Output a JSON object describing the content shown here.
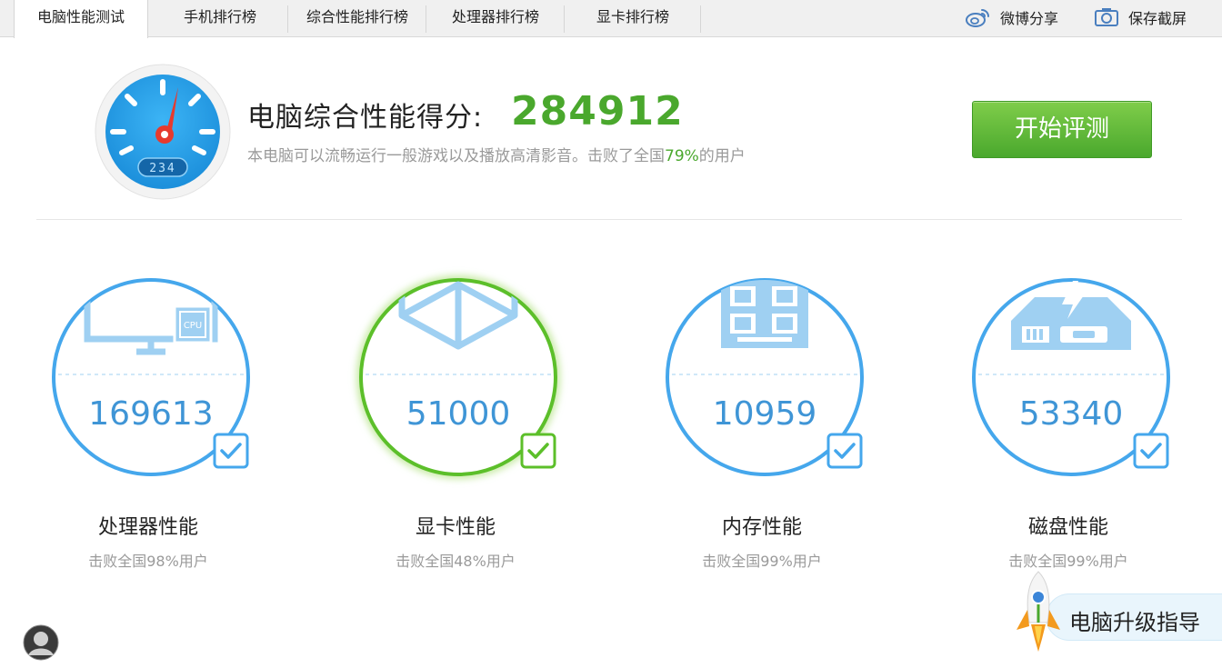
{
  "tabs": [
    {
      "label": "电脑性能测试",
      "active": true
    },
    {
      "label": "手机排行榜"
    },
    {
      "label": "综合性能排行榜"
    },
    {
      "label": "处理器排行榜"
    },
    {
      "label": "显卡排行榜"
    }
  ],
  "actions": {
    "weibo_share": "微博分享",
    "save_screenshot": "保存截屏"
  },
  "score": {
    "title": "电脑综合性能得分:",
    "value": "284912",
    "desc_prefix": "本电脑可以流畅运行一般游戏以及播放高清影音。击败了全国",
    "desc_pct": "79%",
    "desc_suffix": "的用户",
    "gauge_display": "234"
  },
  "start_button": "开始评测",
  "components": [
    {
      "name": "处理器性能",
      "score": "169613",
      "beat": "击败全国98%用户",
      "icon": "cpu-monitor-icon",
      "highlight": false
    },
    {
      "name": "显卡性能",
      "score": "51000",
      "beat": "击败全国48%用户",
      "icon": "cube-icon",
      "highlight": true
    },
    {
      "name": "内存性能",
      "score": "10959",
      "beat": "击败全国99%用户",
      "icon": "memory-chip-icon",
      "highlight": false
    },
    {
      "name": "磁盘性能",
      "score": "53340",
      "beat": "击败全国99%用户",
      "icon": "disk-drive-icon",
      "highlight": false
    }
  ],
  "upgrade_guide": "电脑升级指导",
  "colors": {
    "accent_blue": "#45a7ec",
    "accent_green": "#5cbf2a",
    "score_green": "#4aa82d"
  }
}
